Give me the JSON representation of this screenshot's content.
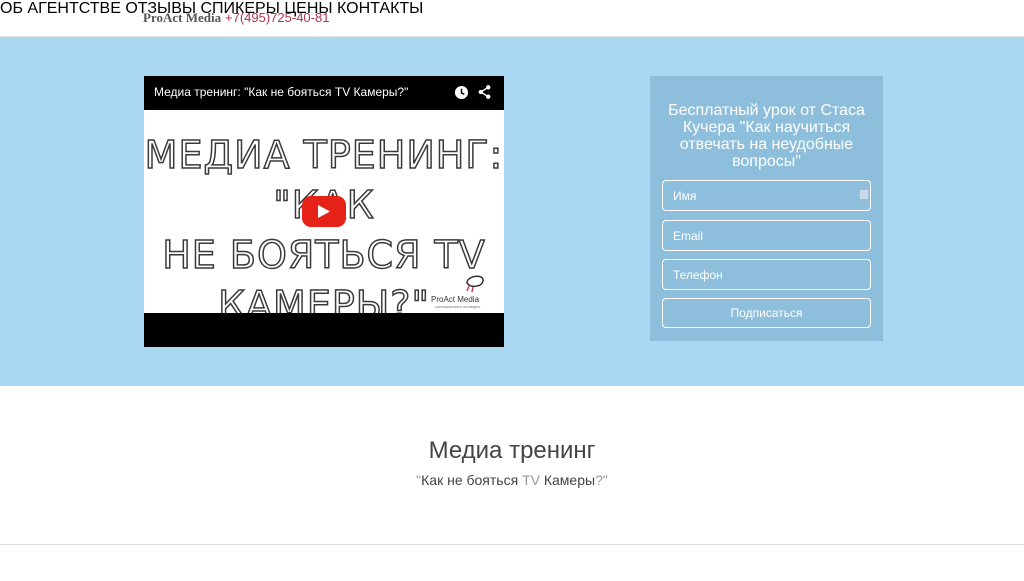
{
  "header": {
    "brand": "ProAct Media",
    "phone": "+7(495)725-40-81",
    "nav": [
      {
        "label": "ОБ АГЕНТСТВЕ"
      },
      {
        "label": "ОТЗЫВЫ"
      },
      {
        "label": "СПИКЕРЫ"
      },
      {
        "label": "ЦЕНЫ"
      },
      {
        "label": "КОНТАКТЫ"
      }
    ]
  },
  "video": {
    "title": "Медиа тренинг: \"Как не бояться TV Камеры?\"",
    "thumbnail_text_lines": [
      "Медиа тренинг: \"Как",
      "не бояться TV",
      "Камеры?\""
    ],
    "logo_text": "ProAct Media",
    "logo_subtext": "communication strategies",
    "icons": [
      "watch-later-icon",
      "share-icon",
      "play-icon"
    ]
  },
  "form": {
    "title": "Бесплатный урок от Стаса Кучера \"Как научиться отвечать на неудобные вопросы\"",
    "name_placeholder": "Имя",
    "email_placeholder": "Email",
    "phone_placeholder": "Телефон",
    "submit_label": "Подписаться"
  },
  "section": {
    "title": "Медиа тренинг",
    "subtitle_open": "\"",
    "subtitle_part1": "Как не бояться ",
    "subtitle_tv": "TV",
    "subtitle_part2": " Камеры",
    "subtitle_close": "?\""
  },
  "colors": {
    "hero_bg": "#aad7f2",
    "form_panel_bg": "#8dbfdc",
    "phone_accent": "#b3344a",
    "play_button": "#e62117"
  }
}
